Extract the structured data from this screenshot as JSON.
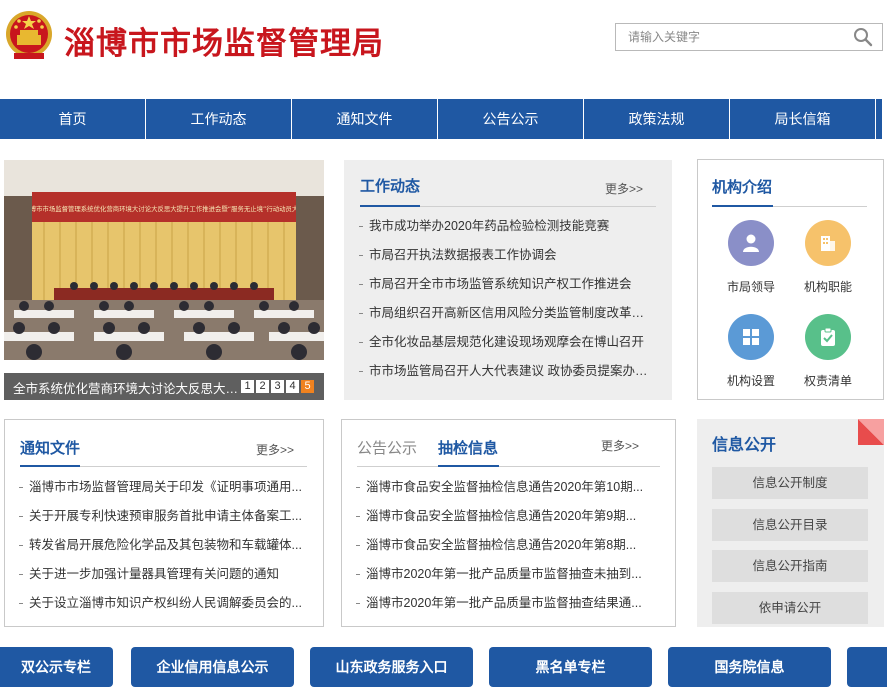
{
  "header": {
    "site_title": "淄博市市场监督管理局",
    "search_placeholder": "请输入关键字"
  },
  "nav": {
    "items": [
      {
        "label": "首页"
      },
      {
        "label": "工作动态"
      },
      {
        "label": "通知文件"
      },
      {
        "label": "公告公示"
      },
      {
        "label": "政策法规"
      },
      {
        "label": "局长信箱"
      }
    ]
  },
  "slideshow": {
    "banner_text": "淄博市市场监督管理系统优化营商环境大讨论大反思大提升工作推进会暨“服务无止境”行动动员大会",
    "caption": "全市系统优化营商环境大讨论大反思大提...",
    "pages": [
      "1",
      "2",
      "3",
      "4",
      "5"
    ],
    "active_page": "5"
  },
  "work_news": {
    "title": "工作动态",
    "more": "更多>>",
    "items": [
      "我市成功举办2020年药品检验检测技能竞赛",
      "市局召开执法数据报表工作协调会",
      "市局召开全市市场监管系统知识产权工作推进会",
      "市局组织召开高新区信用风险分类监管制度改革创...",
      "全市化妆品基层规范化建设现场观摩会在博山召开",
      "市市场监管局召开人大代表建议 政协委员提案办理..."
    ]
  },
  "org_intro": {
    "title": "机构介绍",
    "items": [
      {
        "label": "市局领导",
        "icon": "leader-icon",
        "color": "#8a8fc8"
      },
      {
        "label": "机构职能",
        "icon": "building-icon",
        "color": "#f6c26b"
      },
      {
        "label": "机构设置",
        "icon": "grid-icon",
        "color": "#5b9ad6"
      },
      {
        "label": "权责清单",
        "icon": "clipboard-check-icon",
        "color": "#58c08a"
      }
    ]
  },
  "notices": {
    "title": "通知文件",
    "more": "更多>>",
    "items": [
      "淄博市市场监督管理局关于印发《证明事项通用...",
      "关于开展专利快速预审服务首批申请主体备案工...",
      "转发省局开展危险化学品及其包装物和车载罐体...",
      "关于进一步加强计量器具管理有关问题的通知",
      "关于设立淄博市知识产权纠纷人民调解委员会的..."
    ]
  },
  "inspections": {
    "tab_inactive": "公告公示",
    "tab_active": "抽检信息",
    "more": "更多>>",
    "items": [
      "淄博市食品安全监督抽检信息通告2020年第10期...",
      "淄博市食品安全监督抽检信息通告2020年第9期...",
      "淄博市食品安全监督抽检信息通告2020年第8期...",
      "淄博市2020年第一批产品质量市监督抽查未抽到...",
      "淄博市2020年第一批产品质量市监督抽查结果通..."
    ]
  },
  "info_disclosure": {
    "title": "信息公开",
    "buttons": [
      "信息公开制度",
      "信息公开目录",
      "信息公开指南",
      "依申请公开"
    ]
  },
  "bottom_links": [
    "双公示专栏",
    "企业信用信息公示",
    "山东政务服务入口",
    "黑名单专栏",
    "国务院信息"
  ],
  "colors": {
    "brand_red": "#c8161d",
    "nav_blue": "#1f58a3",
    "active_page_orange": "#f0821f"
  }
}
